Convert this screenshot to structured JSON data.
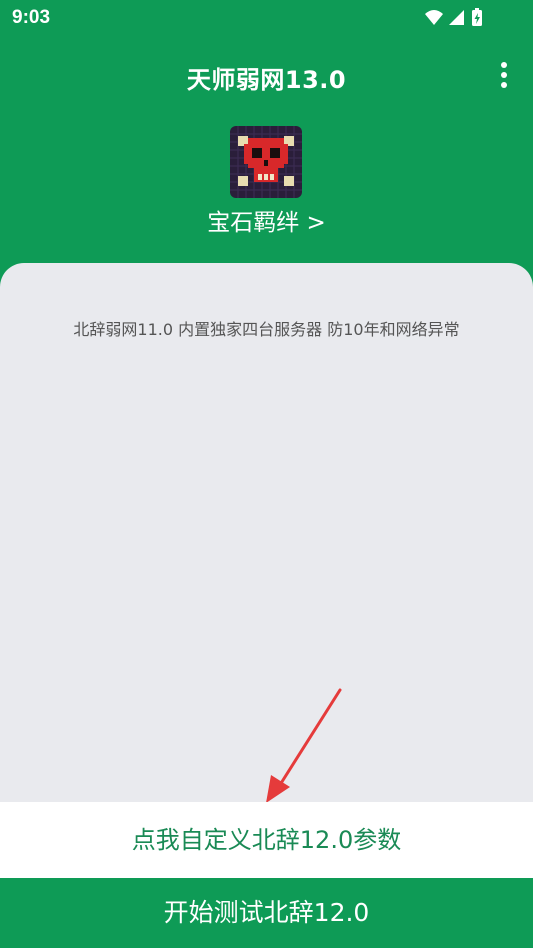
{
  "status_bar": {
    "time": "9:03"
  },
  "app_bar": {
    "title": "天师弱网13.0",
    "menu_icon": "more-vertical-icon"
  },
  "header": {
    "logo_icon": "skull-icon",
    "link_label": "宝石羁绊 >"
  },
  "card": {
    "description": "北辞弱网11.0 内置独家四台服务器 防10年和网络异常"
  },
  "actions": {
    "custom_label": "点我自定义北辞12.0参数",
    "start_label": "开始测试北辞12.0"
  },
  "colors": {
    "primary": "#0e9b56",
    "card_bg": "#e9eaee",
    "accent_text": "#1a8a55",
    "arrow": "#e53b3b"
  }
}
